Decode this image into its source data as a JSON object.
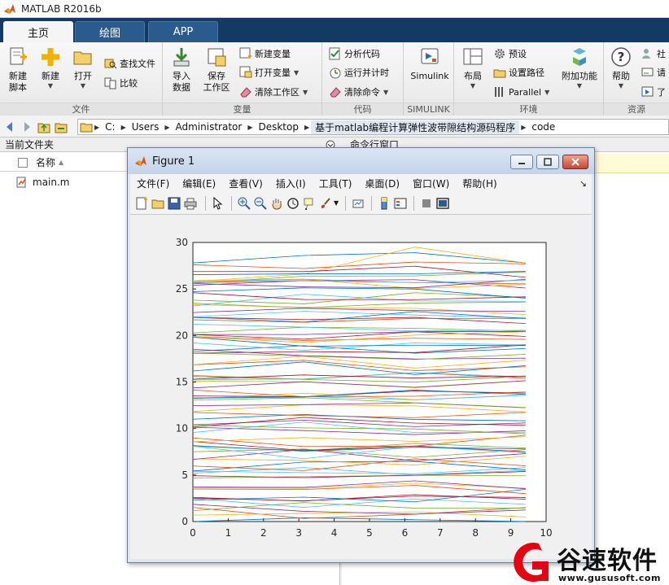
{
  "window": {
    "title": "MATLAB R2016b"
  },
  "tabs": [
    {
      "label": "主页",
      "active": true
    },
    {
      "label": "绘图",
      "active": false
    },
    {
      "label": "APP",
      "active": false
    }
  ],
  "ribbon": {
    "file": {
      "label": "文件",
      "new_script": "新建\n脚本",
      "new": "新建",
      "open": "打开",
      "find_files": "查找文件",
      "compare": "比较"
    },
    "variable": {
      "label": "变量",
      "import_data": "导入\n数据",
      "save_workspace": "保存\n工作区",
      "new_variable": "新建变量",
      "open_variable": "打开变量",
      "clear_workspace": "清除工作区"
    },
    "code": {
      "label": "代码",
      "analyze_code": "分析代码",
      "run_and_time": "运行并计时",
      "clear_commands": "清除命令"
    },
    "simulink": {
      "label": "SIMULINK",
      "simulink": "Simulink"
    },
    "environment": {
      "label": "环境",
      "layout": "布局",
      "preferences": "预设",
      "set_path": "设置路径",
      "parallel": "Parallel",
      "add_ons": "附加功能"
    },
    "resources": {
      "label": "资源",
      "help": "帮助",
      "community": "社",
      "request": "请",
      "learn": "了"
    }
  },
  "address": {
    "crumbs": [
      "C:",
      "Users",
      "Administrator",
      "Desktop",
      "基于matlab编程计算弹性波带隙结构源码程序",
      "code"
    ]
  },
  "left_panel": {
    "header": "当前文件夹",
    "column_name": "名称",
    "sort_indicator": "▲",
    "files": [
      "main.m"
    ]
  },
  "right_panel": {
    "header": "命令行窗口"
  },
  "figure": {
    "title": "Figure 1",
    "menu": [
      "文件(F)",
      "编辑(E)",
      "查看(V)",
      "插入(I)",
      "工具(T)",
      "桌面(D)",
      "窗口(W)",
      "帮助(H)"
    ],
    "menu_dock": "↘"
  },
  "chart_data": {
    "type": "line",
    "title": "",
    "xlabel": "",
    "ylabel": "",
    "xlim": [
      0,
      10
    ],
    "ylim": [
      0,
      30
    ],
    "xticks": [
      0,
      1,
      2,
      3,
      4,
      5,
      6,
      7,
      8,
      9,
      10
    ],
    "yticks": [
      0,
      5,
      10,
      15,
      20,
      25,
      30
    ],
    "grid": false,
    "x": [
      0,
      3.14,
      6.28,
      9.42
    ],
    "series_count": 70,
    "sample_series": [
      {
        "values": [
          27.8,
          28.6,
          28.9,
          27.8
        ]
      },
      {
        "values": [
          27.6,
          27.2,
          27.9,
          27.7
        ]
      },
      {
        "values": [
          25.8,
          26.6,
          29.5,
          27.8
        ]
      },
      {
        "values": [
          25.4,
          25.9,
          26.0,
          25.1
        ]
      },
      {
        "values": [
          23.8,
          23.4,
          24.6,
          24.1
        ]
      },
      {
        "values": [
          22.0,
          22.6,
          22.2,
          21.9
        ]
      },
      {
        "values": [
          20.1,
          19.6,
          20.4,
          19.9
        ]
      },
      {
        "values": [
          18.3,
          18.9,
          18.1,
          18.6
        ]
      },
      {
        "values": [
          15.6,
          15.3,
          16.0,
          15.4
        ]
      },
      {
        "values": [
          13.2,
          13.8,
          13.1,
          13.6
        ]
      },
      {
        "values": [
          10.4,
          10.9,
          10.2,
          10.6
        ]
      },
      {
        "values": [
          8.1,
          7.6,
          8.4,
          7.9
        ]
      },
      {
        "values": [
          5.2,
          5.8,
          5.0,
          5.5
        ]
      },
      {
        "values": [
          2.6,
          2.2,
          2.9,
          2.4
        ]
      },
      {
        "values": [
          0.0,
          0.4,
          0.2,
          0.0
        ]
      }
    ],
    "colors": [
      "#0072bd",
      "#d95319",
      "#edb120",
      "#7e2f8e",
      "#77ac30",
      "#4dbeee",
      "#a2142f"
    ]
  },
  "watermark": {
    "text": "谷速软件",
    "url": "www.gususoft.com",
    "color": "#e60012"
  }
}
